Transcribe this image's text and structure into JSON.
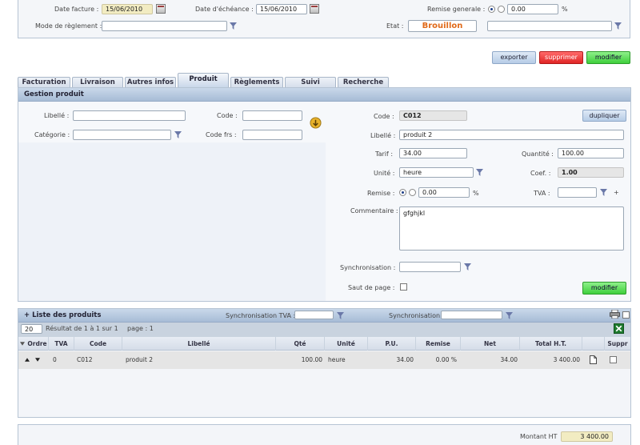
{
  "top": {
    "date_facture_label": "Date facture :",
    "date_facture_value": "15/06/2010",
    "date_echeance_label": "Date d'échéance :",
    "date_echeance_value": "15/06/2010",
    "remise_generale_label": "Remise generale :",
    "remise_generale_value": "0.00",
    "percent": "%",
    "mode_reglement_label": "Mode de règlement :",
    "etat_label": "Etat :",
    "etat_value": "Brouillon"
  },
  "actions": {
    "exporter": "exporter",
    "supprimer": "supprimer",
    "modifier": "modifier"
  },
  "tabs": [
    "Facturation",
    "Livraison",
    "Autres infos",
    "Produit",
    "Règlements",
    "Suivi",
    "Recherche"
  ],
  "gestion": {
    "title": "Gestion produit",
    "search": {
      "libelle_label": "Libellé :",
      "code_label": "Code :",
      "categorie_label": "Catégorie :",
      "code_frs_label": "Code frs :"
    },
    "form": {
      "code_label": "Code :",
      "code_value": "C012",
      "dupliquer": "dupliquer",
      "libelle_label": "Libellé :",
      "libelle_value": "produit 2",
      "tarif_label": "Tarif :",
      "tarif_value": "34.00",
      "quantite_label": "Quantité :",
      "quantite_value": "100.00",
      "unite_label": "Unité :",
      "unite_value": "heure",
      "coef_label": "Coef. :",
      "coef_value": "1.00",
      "remise_label": "Remise :",
      "remise_value": "0.00",
      "percent": "%",
      "tva_label": "TVA :",
      "plus": "+",
      "commentaire_label": "Commentaire :",
      "commentaire_value": "gfghjkl",
      "synchro_label": "Synchronisation :",
      "saut_label": "Saut de page :",
      "modifier": "modifier"
    }
  },
  "liste": {
    "title": "+ Liste des produits",
    "synchro_tva_label": "Synchronisation TVA :",
    "synchro_label": "Synchronisation :",
    "per_page": "20",
    "result_text": "Résultat de 1 à 1 sur 1",
    "page_text": "page : 1",
    "columns": [
      "Ordre",
      "TVA",
      "Code",
      "Libellé",
      "Qté",
      "Unité",
      "P.U.",
      "Remise",
      "Net",
      "Total H.T.",
      "",
      "Suppr"
    ],
    "rows": [
      {
        "tva": "0",
        "code": "C012",
        "libelle": "produit 2",
        "qte": "100.00",
        "unite": "heure",
        "pu": "34.00",
        "remise": "0.00 %",
        "net": "34.00",
        "total": "3 400.00"
      }
    ]
  },
  "footer": {
    "montant_label": "Montant HT",
    "montant_value": "3 400.00"
  },
  "colors": {
    "etat_text": "#e06a1a",
    "header_blue": "#b3c6de",
    "exporter_btn": "#c8d8ec",
    "supprimer_btn": "#e83a3a",
    "modifier_btn": "#5bd858"
  }
}
